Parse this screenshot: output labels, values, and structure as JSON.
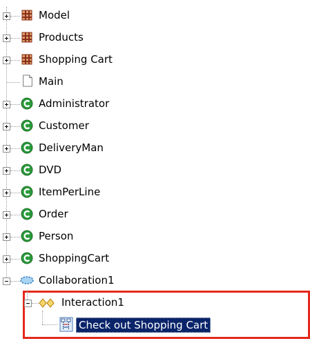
{
  "tree": {
    "items": [
      {
        "label": "Model",
        "icon": "package-icon",
        "expander": "plus"
      },
      {
        "label": "Products",
        "icon": "package-icon",
        "expander": "plus"
      },
      {
        "label": "Shopping Cart",
        "icon": "package-icon",
        "expander": "plus"
      },
      {
        "label": "Main",
        "icon": "document-icon",
        "expander": "none"
      },
      {
        "label": "Administrator",
        "icon": "class-icon",
        "expander": "plus"
      },
      {
        "label": "Customer",
        "icon": "class-icon",
        "expander": "plus"
      },
      {
        "label": "DeliveryMan",
        "icon": "class-icon",
        "expander": "plus"
      },
      {
        "label": "DVD",
        "icon": "class-icon",
        "expander": "plus"
      },
      {
        "label": "ItemPerLine",
        "icon": "class-icon",
        "expander": "plus"
      },
      {
        "label": "Order",
        "icon": "class-icon",
        "expander": "plus"
      },
      {
        "label": "Person",
        "icon": "class-icon",
        "expander": "plus"
      },
      {
        "label": "ShoppingCart",
        "icon": "class-icon",
        "expander": "plus"
      },
      {
        "label": "Collaboration1",
        "icon": "collaboration-icon",
        "expander": "minus"
      }
    ],
    "interaction": {
      "label": "Interaction1",
      "icon": "interaction-icon",
      "expander": "minus"
    },
    "selected": {
      "label": "Check out Shopping Cart",
      "icon": "sequence-diagram-icon"
    }
  },
  "colors": {
    "selection_bg": "#0a246a",
    "highlight_border": "#e4281d",
    "class_icon": "#2a9a3a",
    "package_icon": "#8b2d1b"
  }
}
